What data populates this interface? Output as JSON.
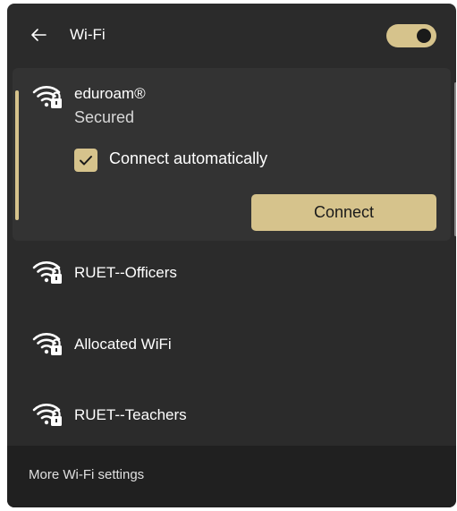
{
  "header": {
    "back_icon": "arrow-left-icon",
    "title": "Wi-Fi",
    "wifi_toggle_on": true
  },
  "networks": {
    "selected": {
      "name": "eduroam®",
      "status": "Secured",
      "icon": "wifi-secured-icon",
      "connect_automatically_label": "Connect automatically",
      "connect_automatically_checked": true,
      "connect_label": "Connect"
    },
    "others": [
      {
        "name": "RUET--Officers",
        "icon": "wifi-secured-icon"
      },
      {
        "name": "Allocated WiFi",
        "icon": "wifi-secured-icon"
      },
      {
        "name": "RUET--Teachers",
        "icon": "wifi-secured-icon"
      }
    ]
  },
  "footer": {
    "more_settings_label": "More Wi-Fi settings"
  },
  "colors": {
    "accent": "#d6c38c",
    "panel": "#2b2b2b",
    "selected_bg": "#333333",
    "footer_bg": "#202020"
  }
}
